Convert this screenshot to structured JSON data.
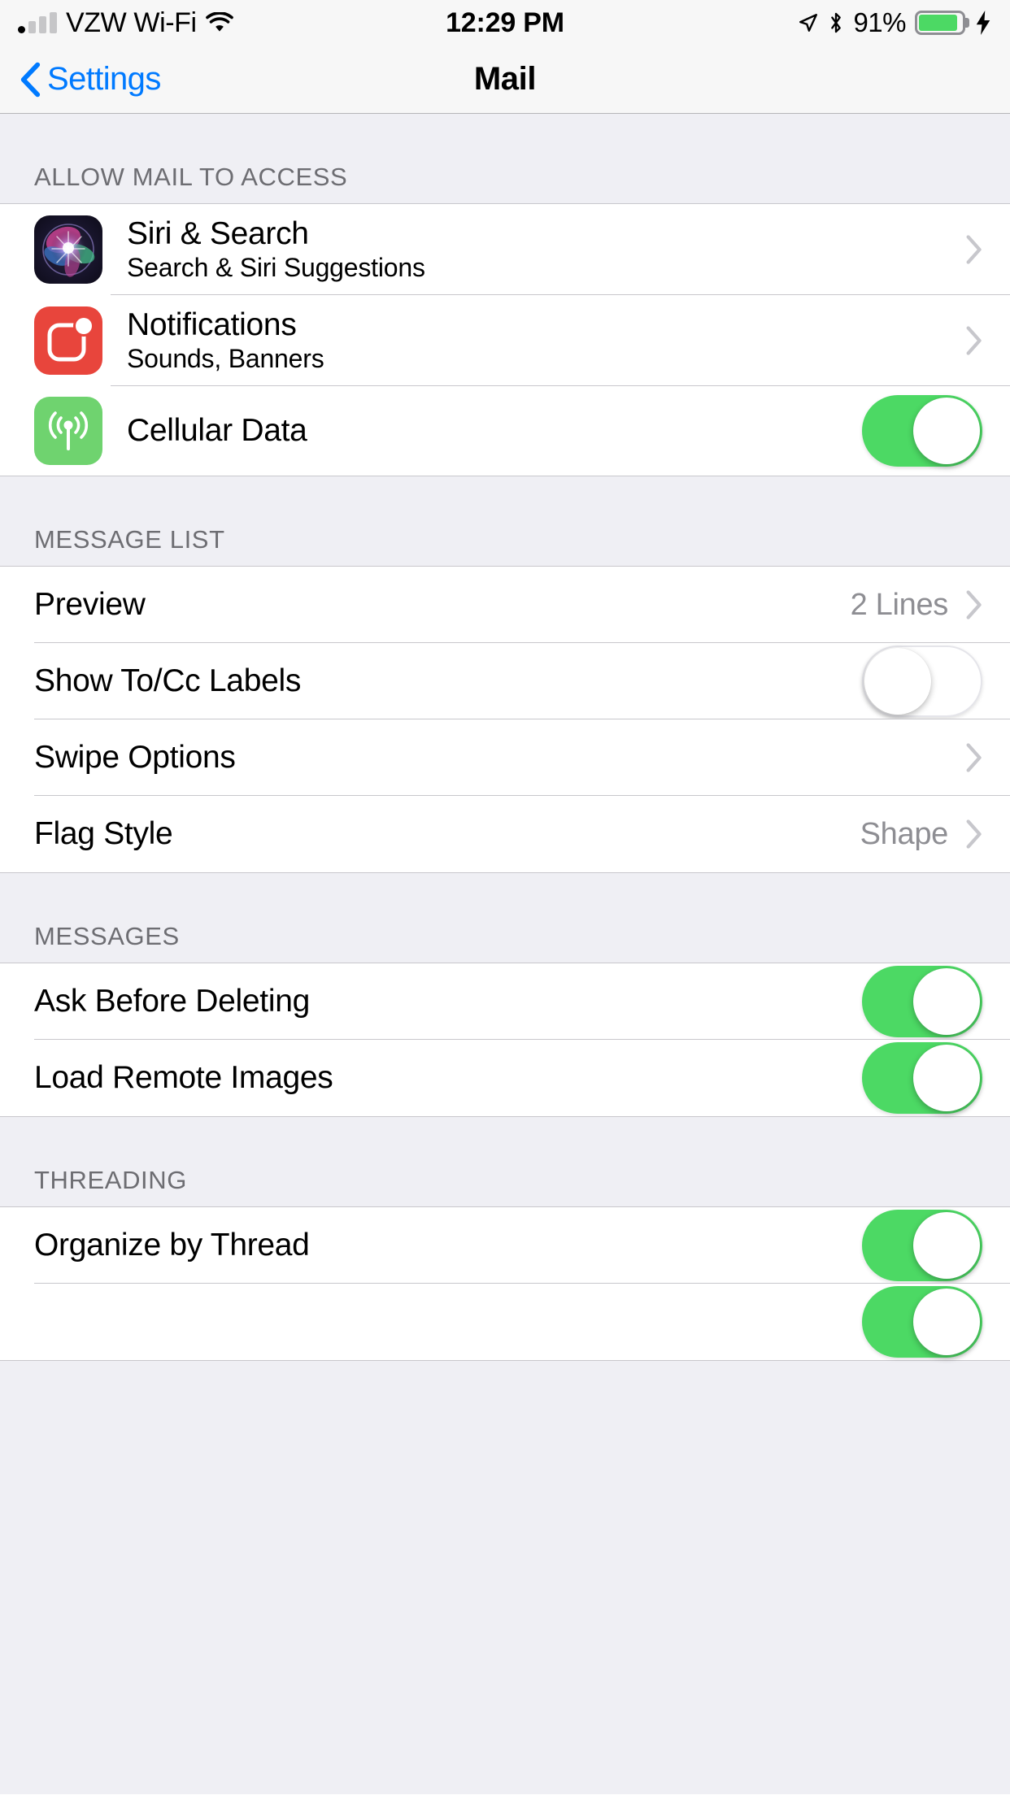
{
  "status_bar": {
    "carrier": "VZW Wi-Fi",
    "wifi_icon": "wifi-icon",
    "signal_icon": "cellular-signal-icon",
    "time": "12:29 PM",
    "location_icon": "location-arrow-icon",
    "bluetooth_icon": "bluetooth-icon",
    "battery_percent": "91%",
    "battery_icon": "battery-icon",
    "charging_icon": "lightning-bolt-icon"
  },
  "nav": {
    "back_label": "Settings",
    "back_icon": "chevron-left-icon",
    "title": "Mail"
  },
  "sections": [
    {
      "header": "ALLOW MAIL TO ACCESS",
      "rows": [
        {
          "title": "Siri & Search",
          "subtitle": "Search & Siri Suggestions",
          "icon": "siri-icon",
          "accessory": "chevron"
        },
        {
          "title": "Notifications",
          "subtitle": "Sounds, Banners",
          "icon": "notifications-icon",
          "accessory": "chevron"
        },
        {
          "title": "Cellular Data",
          "subtitle": "",
          "icon": "cellular-data-icon",
          "accessory": "toggle",
          "toggle_on": true
        }
      ]
    },
    {
      "header": "MESSAGE LIST",
      "rows": [
        {
          "title": "Preview",
          "value": "2 Lines",
          "accessory": "chevron-value"
        },
        {
          "title": "Show To/Cc Labels",
          "accessory": "toggle",
          "toggle_on": false
        },
        {
          "title": "Swipe Options",
          "accessory": "chevron"
        },
        {
          "title": "Flag Style",
          "value": "Shape",
          "accessory": "chevron-value"
        }
      ]
    },
    {
      "header": "MESSAGES",
      "rows": [
        {
          "title": "Ask Before Deleting",
          "accessory": "toggle",
          "toggle_on": true
        },
        {
          "title": "Load Remote Images",
          "accessory": "toggle",
          "toggle_on": true
        }
      ]
    },
    {
      "header": "THREADING",
      "rows": [
        {
          "title": "Organize by Thread",
          "accessory": "toggle",
          "toggle_on": true
        },
        {
          "title": "",
          "accessory": "toggle",
          "toggle_on": true
        }
      ]
    }
  ],
  "colors": {
    "accent_blue": "#007aff",
    "toggle_on_green": "#4cd964",
    "group_bg": "#ffffff",
    "page_bg": "#efeff4",
    "header_text": "#6d6d72",
    "value_text": "#8e8e93",
    "separator": "#c8c7cc",
    "notifications_red": "#e8453c",
    "cellular_green": "#6fd36f"
  }
}
